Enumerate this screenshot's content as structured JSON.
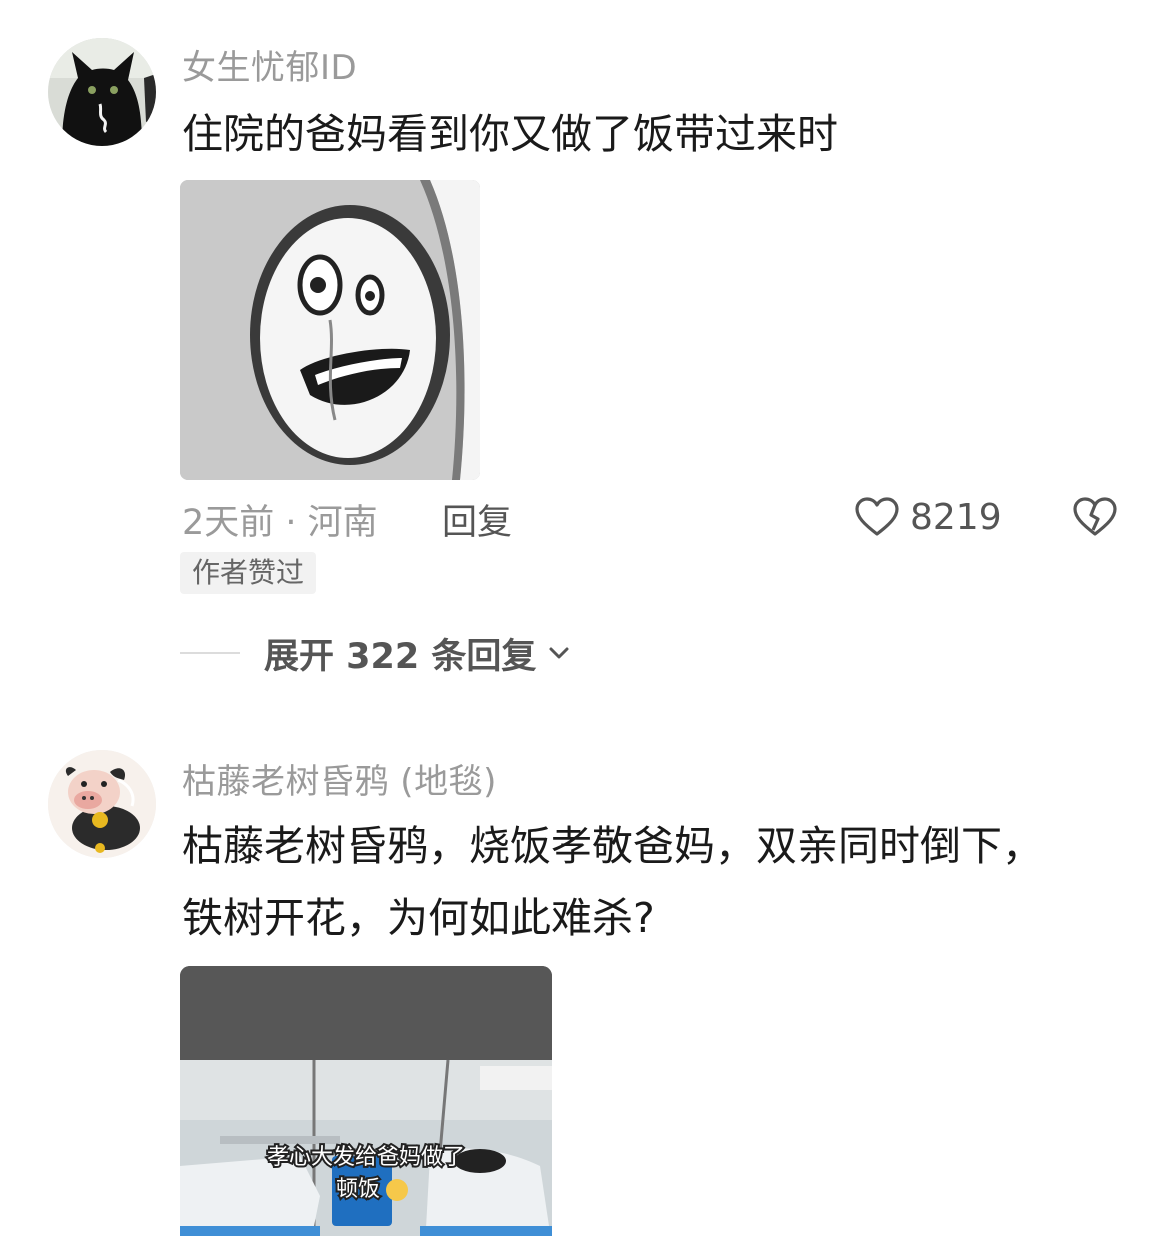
{
  "comments": [
    {
      "username": "女生忧郁ID",
      "avatar": "black-cat-avatar",
      "text": "住院的爸妈看到你又做了饭带过来时",
      "image": "ghost-meme-image",
      "meta": "2天前 · 河南",
      "reply_label": "回复",
      "like_count": "8219",
      "badge": "作者赞过",
      "expand_label": "展开 322 条回复"
    },
    {
      "username": "枯藤老树昏鸦 (地毯)",
      "avatar": "cartoon-cow-avatar",
      "text": "枯藤老树昏鸦，烧饭孝敬爸妈，双亲同时倒下，\n铁树开花，为何如此难杀?",
      "image": "hospital-video-thumbnail",
      "image_caption_line1": "孝心大发给爸妈做了",
      "image_caption_line2": "顿饭"
    }
  ],
  "icons": {
    "like": "heart-outline-icon",
    "dislike": "broken-heart-icon",
    "expand": "chevron-down-icon"
  },
  "colors": {
    "username": "#9a9a9a",
    "text": "#1a1a1a",
    "secondary": "#555555",
    "badge_bg": "#f2f2f2"
  }
}
